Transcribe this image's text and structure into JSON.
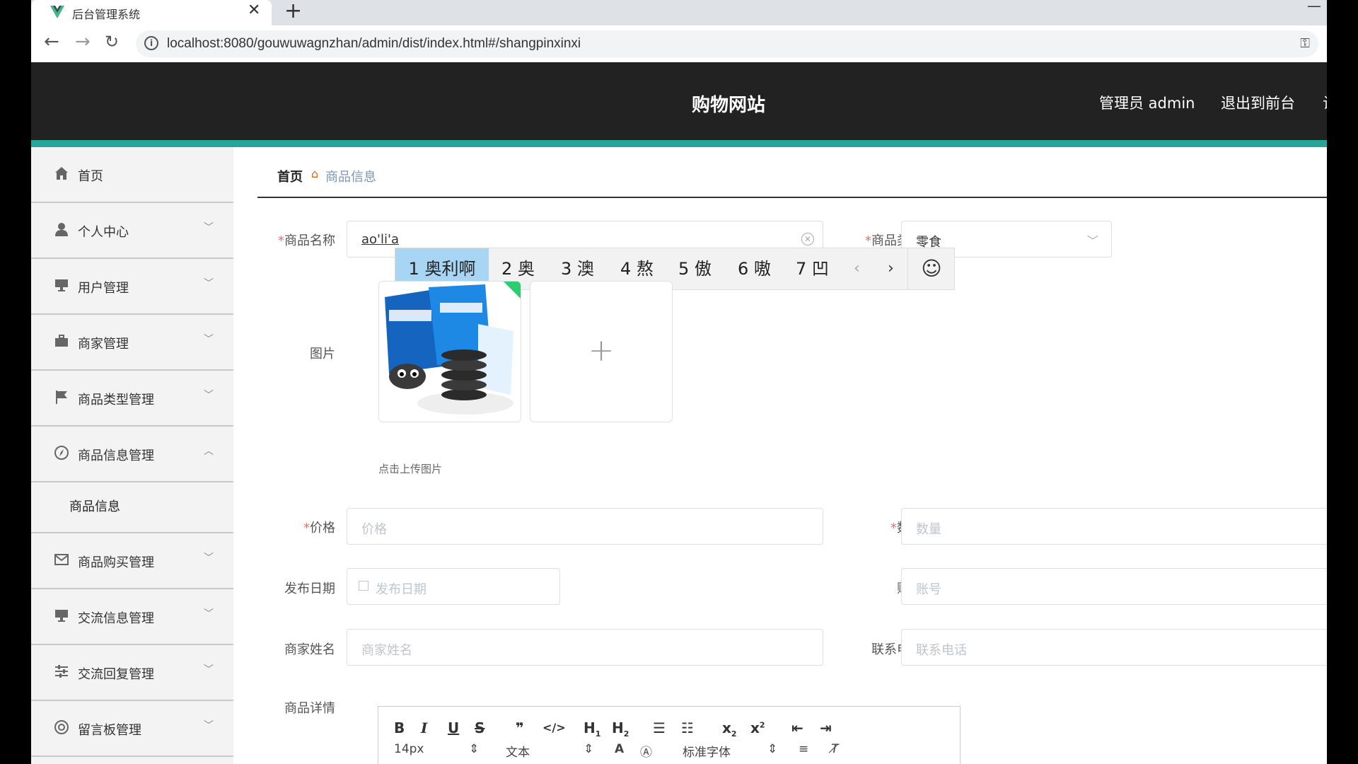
{
  "browser": {
    "tab_title": "后台管理系统",
    "url": "localhost:8080/gouwuwagnzhan/admin/dist/index.html#/shangpinxinxi"
  },
  "header": {
    "site_title": "购物网站",
    "user": "管理员 admin",
    "exit": "退出到前台",
    "extra": "让"
  },
  "sidebar": {
    "items": [
      {
        "label": "首页",
        "icon": "home-icon",
        "arrow": ""
      },
      {
        "label": "个人中心",
        "icon": "user-icon",
        "arrow": "﹀"
      },
      {
        "label": "用户管理",
        "icon": "monitor-icon",
        "arrow": "﹀"
      },
      {
        "label": "商家管理",
        "icon": "briefcase-icon",
        "arrow": "﹀"
      },
      {
        "label": "商品类型管理",
        "icon": "flag-icon",
        "arrow": "﹀"
      },
      {
        "label": "商品信息管理",
        "icon": "compass-icon",
        "arrow": "︿"
      },
      {
        "label": "商品购买管理",
        "icon": "mail-icon",
        "arrow": "﹀"
      },
      {
        "label": "交流信息管理",
        "icon": "monitor-icon",
        "arrow": "﹀"
      },
      {
        "label": "交流回复管理",
        "icon": "sliders-icon",
        "arrow": "﹀"
      },
      {
        "label": "留言板管理",
        "icon": "target-icon",
        "arrow": "﹀"
      }
    ],
    "subitem": "商品信息"
  },
  "breadcrumb": {
    "home": "首页",
    "current": "商品信息"
  },
  "form": {
    "name_label": "商品名称",
    "name_value": "ao'li'a",
    "type_label": "商品类型",
    "type_value": "零食",
    "image_label": "图片",
    "upload_tip": "点击上传图片",
    "price_label": "价格",
    "price_placeholder": "价格",
    "qty_label": "数量",
    "qty_placeholder": "数量",
    "date_label": "发布日期",
    "date_placeholder": "发布日期",
    "account_label": "账号",
    "account_placeholder": "账号",
    "merchant_label": "商家姓名",
    "merchant_placeholder": "商家姓名",
    "phone_label": "联系电话",
    "phone_placeholder": "联系电话",
    "detail_label": "商品详情",
    "required_mark": "*"
  },
  "ime": {
    "candidates": [
      "1 奥利啊",
      "2 奥",
      "3 澳",
      "4 熬",
      "5 傲",
      "6 嗷",
      "7 凹"
    ],
    "selected_index": 0
  },
  "editor": {
    "font_size": "14px",
    "paragraph": "文本",
    "font_family": "标准字体"
  }
}
